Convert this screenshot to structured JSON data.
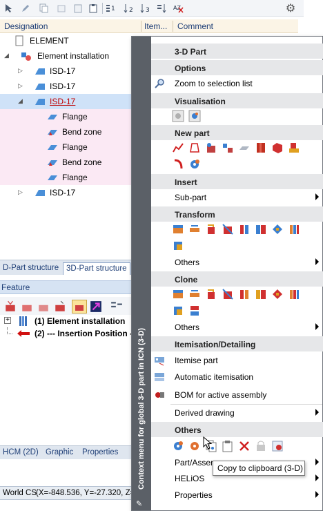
{
  "columns": {
    "designation": "Designation",
    "item": "Item...",
    "comment": "Comment"
  },
  "tree": [
    {
      "label": "ELEMENT"
    },
    {
      "label": "Element installation"
    },
    {
      "label": "ISD-17"
    },
    {
      "label": "ISD-17"
    },
    {
      "label": "ISD-17"
    },
    {
      "label": "Flange"
    },
    {
      "label": "Bend zone"
    },
    {
      "label": "Flange"
    },
    {
      "label": "Bend zone"
    },
    {
      "label": "Flange"
    },
    {
      "label": "ISD-17"
    }
  ],
  "panel_tabs": [
    "D-Part structure",
    "3D-Part structure"
  ],
  "feature_label": "Feature",
  "tree2": [
    {
      "label": "(1) Element installation"
    },
    {
      "label": "(2) --- Insertion Position -"
    }
  ],
  "bottom_tabs": [
    "HCM (2D)",
    "Graphic",
    "Properties"
  ],
  "status": {
    "cs": "World CS",
    "coords": "(X=-848.536, Y=-27.320, Z="
  },
  "menu": {
    "sidebar_title": "Context menu for global 3-D part in ICN (3-D)",
    "header": "3-D Part",
    "sections": {
      "options": "Options",
      "zoom": "Zoom to selection list",
      "visualisation": "Visualisation",
      "new_part": "New part",
      "insert": "Insert",
      "sub_part": "Sub-part",
      "transform": "Transform",
      "transform_others": "Others",
      "clone": "Clone",
      "clone_others": "Others",
      "itemisation": "Itemisation/Detailing",
      "itemise_part": "Itemise part",
      "auto_itemisation": "Automatic itemisation",
      "bom": "BOM for active assembly",
      "derived_drawing": "Derived drawing",
      "others": "Others",
      "part_assembly": "Part/Assen",
      "helios": "HELiOS",
      "properties": "Properties"
    }
  },
  "tooltip": "Copy to clipboard (3-D)",
  "colors": {
    "accent": "#1f3f77",
    "menu_sidebar": "#5b6067",
    "selection": "#cfe2f8",
    "highlight_row": "#fbe9f4",
    "link_red": "#c00000"
  }
}
